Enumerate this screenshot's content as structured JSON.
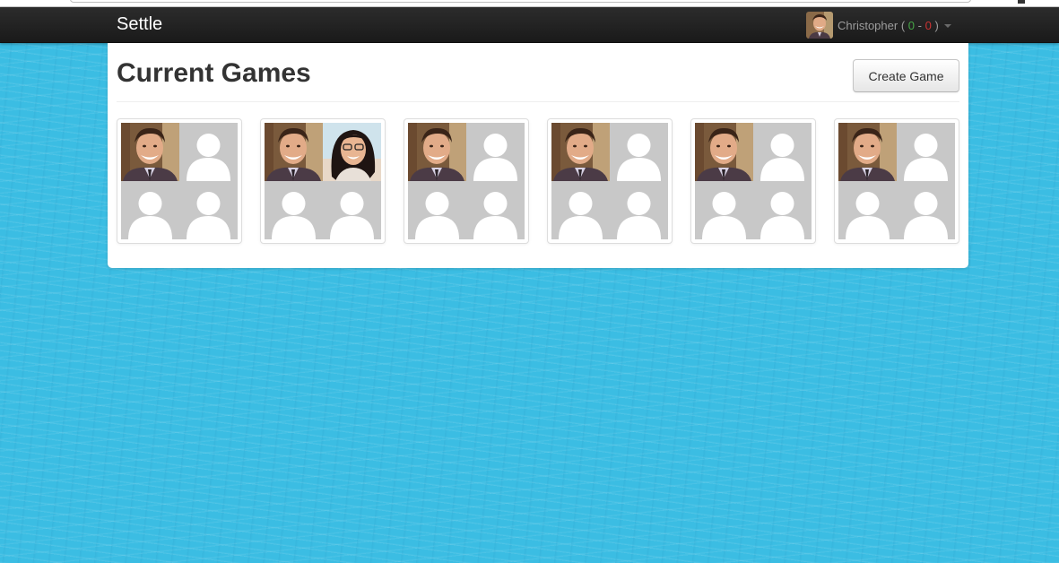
{
  "nav": {
    "brand": "Settle",
    "user": {
      "name": "Christopher",
      "open_paren": "(",
      "wins": "0",
      "sep": "-",
      "losses": "0",
      "close_paren": ")"
    }
  },
  "page": {
    "title": "Current Games",
    "create_button": "Create Game"
  },
  "games": [
    {
      "players": [
        "christopher-photo",
        "placeholder",
        "placeholder",
        "placeholder"
      ]
    },
    {
      "players": [
        "christopher-photo",
        "friend-photo",
        "placeholder",
        "placeholder"
      ]
    },
    {
      "players": [
        "christopher-photo",
        "placeholder",
        "placeholder",
        "placeholder"
      ]
    },
    {
      "players": [
        "christopher-photo",
        "placeholder",
        "placeholder",
        "placeholder"
      ]
    },
    {
      "players": [
        "christopher-photo",
        "placeholder",
        "placeholder",
        "placeholder"
      ]
    },
    {
      "players": [
        "christopher-photo",
        "placeholder",
        "placeholder",
        "placeholder"
      ]
    }
  ],
  "colors": {
    "background": "#3bbde3",
    "navbar": "#222222",
    "win": "#46a546",
    "loss": "#cc3333",
    "placeholder_bg": "#c8c8c8"
  }
}
